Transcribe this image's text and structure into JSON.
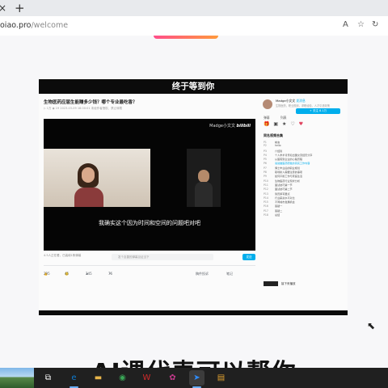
{
  "browser": {
    "tab_close": "×",
    "new_tab": "+",
    "url_prefix": "oiao.pro",
    "url_path": "/welcome",
    "toolbar_icons": [
      "A",
      "☆",
      "↻"
    ]
  },
  "slide": {
    "banner": "终于等到你",
    "caption": "AI课代表可以帮你"
  },
  "video": {
    "title": "生物医药应届生能赚多少钱？哪个专业最吃香？",
    "meta": "▷ 1万  ◉ 19  2023-03-09 18:00:01  未经作者授权，禁止转载",
    "watermark": "Madge小文文",
    "watermark_brand": "bilibili",
    "subtitle": "我确实这个因为时间和空间的问题吧对吧",
    "below_left": "4.5人正在看，已装填1条弹幕",
    "danmu_placeholder": "发个友善的弹幕见证当下",
    "send_label": "发送",
    "actions": [
      {
        "icon": "👍",
        "count": "295"
      },
      {
        "icon": "🪙",
        "count": "45"
      },
      {
        "icon": "★",
        "count": "245"
      },
      {
        "icon": "↗",
        "count": "76"
      }
    ],
    "actions_right": [
      "稿件投诉",
      "笔记"
    ]
  },
  "sidebar": {
    "up_name": "Madge小文文",
    "up_badge": "发消息",
    "up_desc": "生物医药，职业规划，求职经验，人才引进政策",
    "follow_label": "+ 关注 8.1万",
    "tabs": [
      "弹幕",
      "列表"
    ],
    "icons": [
      "🎁",
      "▣",
      "★",
      "♡",
      "♥"
    ],
    "list_head": "同名视频合集",
    "rows": [
      {
        "ix": "P1",
        "t": "前言"
      },
      {
        "ix": "P2",
        "t": "hello"
      },
      {
        "ix": "P3",
        "t": "介绍篇"
      },
      {
        "ix": "P4",
        "t": "个人学术背景和出国交流经历分享"
      },
      {
        "ix": "P5",
        "t": "从医院到企业的心路历程"
      },
      {
        "ix": "P6",
        "t": "说说做医药研发的真实工作内容",
        "active": true
      },
      {
        "ix": "P7",
        "t": "博士毕业后的职业规划"
      },
      {
        "ix": "P8",
        "t": "职场新人需要注意的事项"
      },
      {
        "ix": "P9",
        "t": "如何平衡工作与家庭生活"
      },
      {
        "ix": "P10",
        "t": "生物医药行业现状分析"
      },
      {
        "ix": "P11",
        "t": "面试技巧第一节"
      },
      {
        "ix": "P12",
        "t": "面试技巧第二节"
      },
      {
        "ix": "P13",
        "t": "简历撰写要点"
      },
      {
        "ix": "P14",
        "t": "行业薪资水平对比"
      },
      {
        "ix": "P15",
        "t": "不同城市发展机会"
      },
      {
        "ix": "P16",
        "t": "答疑一"
      },
      {
        "ix": "P17",
        "t": "答疑二"
      },
      {
        "ix": "P18",
        "t": "总结"
      }
    ],
    "footer_label": "接下来播放"
  },
  "taskbar": {
    "apps": [
      {
        "icon": "⧉",
        "name": "task-view"
      },
      {
        "icon": "e",
        "name": "edge",
        "color": "#0f7bd0"
      },
      {
        "icon": "▬",
        "name": "file-explorer",
        "color": "#e8b54a"
      },
      {
        "icon": "◉",
        "name": "chrome",
        "color": "#3aa757"
      },
      {
        "icon": "W",
        "name": "wps",
        "color": "#d22b2b"
      },
      {
        "icon": "✿",
        "name": "app-flower",
        "color": "#c23a8b"
      },
      {
        "icon": "➤",
        "name": "app-arrow",
        "color": "#2d8cff"
      },
      {
        "icon": "▤",
        "name": "app-media",
        "color": "#e0a030"
      }
    ]
  }
}
